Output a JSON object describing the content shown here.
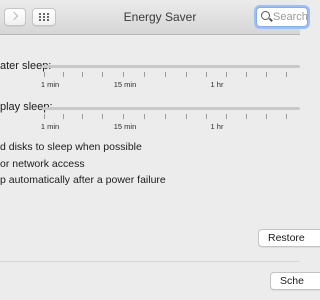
{
  "window": {
    "title": "Energy Saver"
  },
  "search": {
    "placeholder": "Search"
  },
  "computer_sleep": {
    "label": "ater sleep:",
    "ticks": [
      "1 min",
      "15 min",
      "1 hr"
    ]
  },
  "display_sleep": {
    "label": "play sleep:",
    "ticks": [
      "1 min",
      "15 min",
      "1 hr"
    ]
  },
  "options": [
    {
      "label": "d disks to sleep when possible"
    },
    {
      "label": "or network access"
    },
    {
      "label": "p automatically after a power failure"
    }
  ],
  "buttons": {
    "restore": "Restore",
    "schedule": "Sche"
  }
}
